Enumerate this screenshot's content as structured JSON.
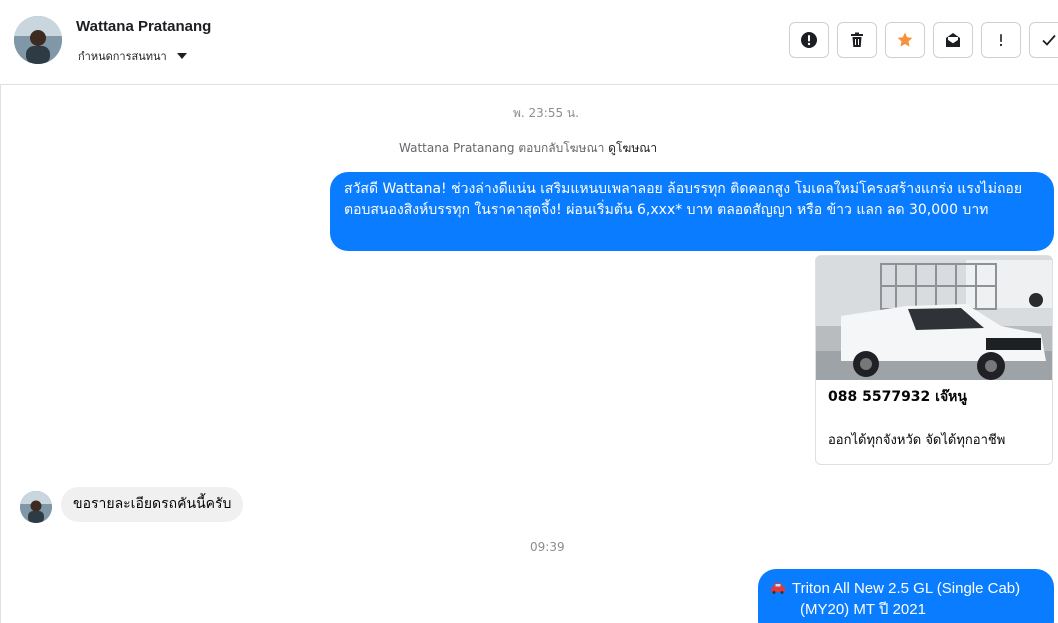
{
  "header": {
    "contact_name": "Wattana Pratanang",
    "assign_label": "กำหนดการสนทนา",
    "toolbar": [
      {
        "name": "spam-button",
        "icon": "alert-circle-icon"
      },
      {
        "name": "delete-button",
        "icon": "trash-icon"
      },
      {
        "name": "star-button",
        "icon": "star-icon"
      },
      {
        "name": "mark-unread-button",
        "icon": "envelope-icon"
      },
      {
        "name": "important-button",
        "icon": "exclamation-icon"
      },
      {
        "name": "done-button",
        "icon": "check-icon"
      }
    ]
  },
  "colors": {
    "accent_blue": "#0a7cff",
    "star_orange": "#f7923b",
    "incoming_bubble": "#f0f0f0"
  },
  "thread": {
    "timestamp_1": "พ. 23:55 น.",
    "system_note": "Wattana Pratanang ตอบกลับโฆษณา",
    "system_note_link": "ดูโฆษณา",
    "outgoing_message_1": "สวัสดี Wattana! ช่วงล่างดีแน่น เสริมแหนบเพลาลอย ล้อบรรทุก ติดคอกสูง โมเดลใหม่โครงสร้างแกร่ง แรงไม่ถอย ตอบสนองสิงห์บรรทุก ในราคาสุดจึ้ง! ผ่อนเริ่มต้น 6,xxx* บาท ตลอดสัญญา หรือ ข้าว แลก ลด 30,000 บาท",
    "ad_card": {
      "title": "088 5577932 เจ๊หนู",
      "subtitle": "ออกได้ทุกจังหวัด จัดได้ทุกอาชีพ"
    },
    "incoming_message_1": "ขอรายละเอียดรถคันนี้ครับ",
    "timestamp_2": "09:39",
    "outgoing_message_2_line1": "Triton All New 2.5 GL (Single Cab)",
    "outgoing_message_2_line2": "(MY20) MT ปี 2021"
  }
}
